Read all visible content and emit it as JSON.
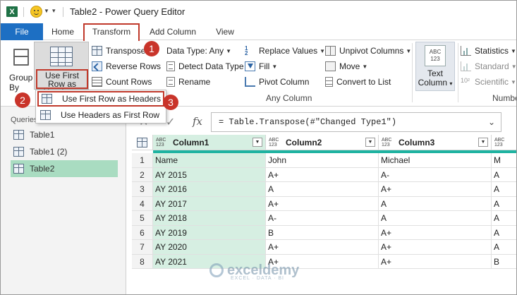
{
  "window": {
    "app_icon": "excel-icon",
    "title": "Table2 - Power Query Editor"
  },
  "tabs": [
    {
      "label": "File"
    },
    {
      "label": "Home"
    },
    {
      "label": "Transform"
    },
    {
      "label": "Add Column"
    },
    {
      "label": "View"
    }
  ],
  "ribbon": {
    "group_by_label": "Group By",
    "use_first_row_label": "Use First Row as Headers",
    "transpose": "Transpose",
    "reverse_rows": "Reverse Rows",
    "count_rows": "Count Rows",
    "data_type": "Data Type: Any",
    "detect_data_type": "Detect Data Type",
    "rename": "Rename",
    "replace_values": "Replace Values",
    "fill": "Fill",
    "pivot_column": "Pivot Column",
    "unpivot_columns": "Unpivot Columns",
    "move": "Move",
    "convert_to_list": "Convert to List",
    "any_column_group": "Any Column",
    "text_column": "Text Column",
    "statistics": "Statistics",
    "standard": "Standard",
    "scientific": "Scientific",
    "number_group": "Numbe"
  },
  "menu": {
    "item1": "Use First Row as Headers",
    "item2": "Use Headers as First Row"
  },
  "badges": [
    "1",
    "2",
    "3"
  ],
  "queries": {
    "label": "Queries",
    "items": [
      "Table1",
      "Table1 (2)",
      "Table2"
    ],
    "active": "Table2"
  },
  "formula": {
    "text": "= Table.Transpose(#\"Changed Type1\")",
    "fx": "fx"
  },
  "table": {
    "type_tag": "ABC 123",
    "columns": [
      "Column1",
      "Column2",
      "Column3",
      ""
    ],
    "rows": [
      {
        "n": "1",
        "c1": "Name",
        "c2": "John",
        "c3": "Michael",
        "c4": "M"
      },
      {
        "n": "2",
        "c1": "AY 2015",
        "c2": "A+",
        "c3": "A-",
        "c4": "A"
      },
      {
        "n": "3",
        "c1": "AY 2016",
        "c2": "A",
        "c3": "A+",
        "c4": "A"
      },
      {
        "n": "4",
        "c1": "AY 2017",
        "c2": "A+",
        "c3": "A",
        "c4": "A"
      },
      {
        "n": "5",
        "c1": "AY 2018",
        "c2": "A-",
        "c3": "A",
        "c4": "A"
      },
      {
        "n": "6",
        "c1": "AY 2019",
        "c2": "B",
        "c3": "A+",
        "c4": "A"
      },
      {
        "n": "7",
        "c1": "AY 2020",
        "c2": "A+",
        "c3": "A+",
        "c4": "A"
      },
      {
        "n": "8",
        "c1": "AY 2021",
        "c2": "A+",
        "c3": "A+",
        "c4": "B"
      }
    ]
  },
  "watermark": {
    "name": "exceldemy",
    "sub": "EXCEL · DATA · BI"
  },
  "colors": {
    "file_tab": "#1d6fc3",
    "highlight_box": "#c0392b",
    "badge": "#c9342a",
    "selected_column": "#d6efe2",
    "active_query": "#a9dcc1",
    "quality_bar": "#1fb3a1"
  }
}
